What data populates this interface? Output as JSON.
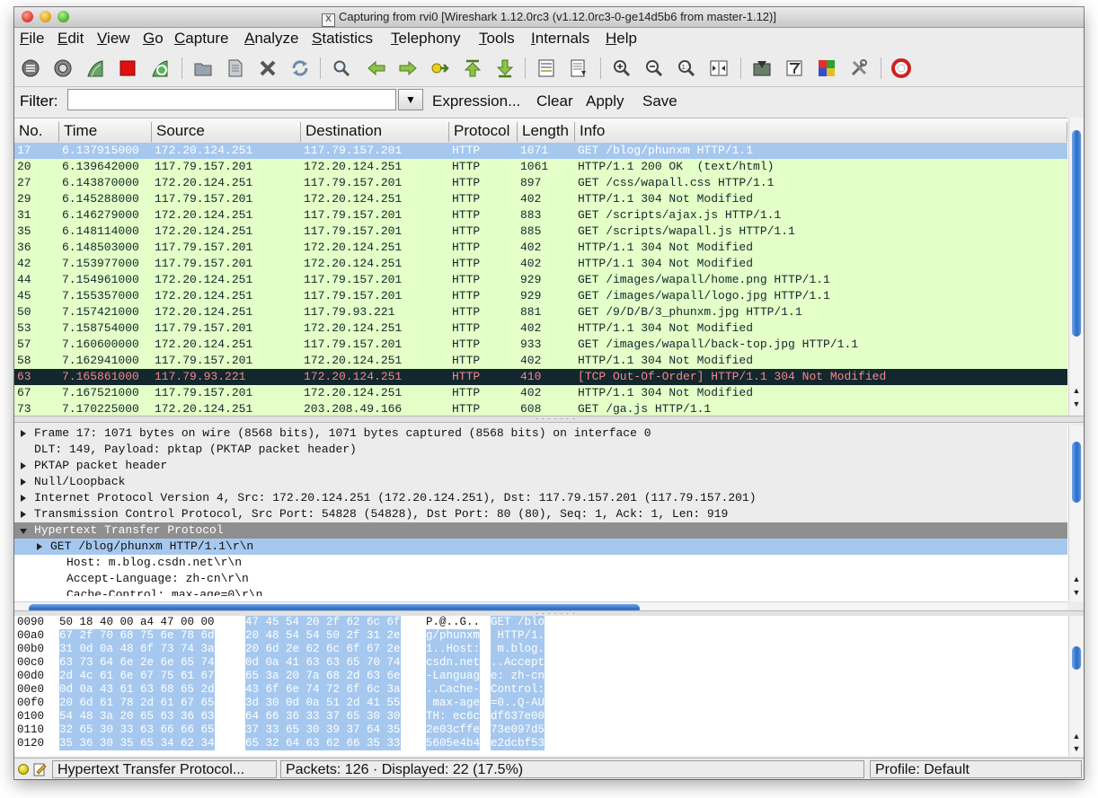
{
  "window": {
    "title": "Capturing from rvi0    [Wireshark 1.12.0rc3  (v1.12.0rc3-0-ge14d5b6 from master-1.12)]",
    "title_badge": "X"
  },
  "menu": [
    "File",
    "Edit",
    "View",
    "Go",
    "Capture",
    "Analyze",
    "Statistics",
    "Telephony",
    "Tools",
    "Internals",
    "Help"
  ],
  "toolbar": {
    "icons": [
      "interfaces-icon",
      "options-icon",
      "start-capture-icon",
      "stop-capture-icon",
      "restart-capture-icon",
      "open-file-icon",
      "save-file-icon",
      "close-file-icon",
      "reload-icon",
      "find-packet-icon",
      "go-back-icon",
      "go-forward-icon",
      "go-to-packet-icon",
      "go-first-icon",
      "go-last-icon",
      "colorize-icon",
      "autoscroll-icon",
      "zoom-in-icon",
      "zoom-out-icon",
      "zoom-normal-icon",
      "resize-columns-icon",
      "capture-filters-icon",
      "display-filters-icon",
      "coloring-rules-icon",
      "preferences-icon",
      "help-icon"
    ]
  },
  "filter": {
    "label": "Filter:",
    "value": "",
    "placeholder": "",
    "expression": "Expression...",
    "clear": "Clear",
    "apply": "Apply",
    "save": "Save"
  },
  "packet_list": {
    "columns": [
      "No.",
      "Time",
      "Source",
      "Destination",
      "Protocol",
      "Length",
      "Info"
    ],
    "rows": [
      {
        "no": "17",
        "time": "6.137915000",
        "src": "172.20.124.251",
        "dst": "117.79.157.201",
        "proto": "HTTP",
        "len": "1071",
        "info": "GET /blog/phunxm HTTP/1.1",
        "state": "sel"
      },
      {
        "no": "20",
        "time": "6.139642000",
        "src": "117.79.157.201",
        "dst": "172.20.124.251",
        "proto": "HTTP",
        "len": "1061",
        "info": "HTTP/1.1 200 OK  (text/html)",
        "state": ""
      },
      {
        "no": "27",
        "time": "6.143870000",
        "src": "172.20.124.251",
        "dst": "117.79.157.201",
        "proto": "HTTP",
        "len": "897",
        "info": "GET /css/wapall.css HTTP/1.1",
        "state": ""
      },
      {
        "no": "29",
        "time": "6.145288000",
        "src": "117.79.157.201",
        "dst": "172.20.124.251",
        "proto": "HTTP",
        "len": "402",
        "info": "HTTP/1.1 304 Not Modified",
        "state": ""
      },
      {
        "no": "31",
        "time": "6.146279000",
        "src": "172.20.124.251",
        "dst": "117.79.157.201",
        "proto": "HTTP",
        "len": "883",
        "info": "GET /scripts/ajax.js HTTP/1.1",
        "state": ""
      },
      {
        "no": "35",
        "time": "6.148114000",
        "src": "172.20.124.251",
        "dst": "117.79.157.201",
        "proto": "HTTP",
        "len": "885",
        "info": "GET /scripts/wapall.js HTTP/1.1",
        "state": ""
      },
      {
        "no": "36",
        "time": "6.148503000",
        "src": "117.79.157.201",
        "dst": "172.20.124.251",
        "proto": "HTTP",
        "len": "402",
        "info": "HTTP/1.1 304 Not Modified",
        "state": ""
      },
      {
        "no": "42",
        "time": "7.153977000",
        "src": "117.79.157.201",
        "dst": "172.20.124.251",
        "proto": "HTTP",
        "len": "402",
        "info": "HTTP/1.1 304 Not Modified",
        "state": ""
      },
      {
        "no": "44",
        "time": "7.154961000",
        "src": "172.20.124.251",
        "dst": "117.79.157.201",
        "proto": "HTTP",
        "len": "929",
        "info": "GET /images/wapall/home.png HTTP/1.1",
        "state": ""
      },
      {
        "no": "45",
        "time": "7.155357000",
        "src": "172.20.124.251",
        "dst": "117.79.157.201",
        "proto": "HTTP",
        "len": "929",
        "info": "GET /images/wapall/logo.jpg HTTP/1.1",
        "state": ""
      },
      {
        "no": "50",
        "time": "7.157421000",
        "src": "172.20.124.251",
        "dst": "117.79.93.221",
        "proto": "HTTP",
        "len": "881",
        "info": "GET /9/D/B/3_phunxm.jpg HTTP/1.1",
        "state": ""
      },
      {
        "no": "53",
        "time": "7.158754000",
        "src": "117.79.157.201",
        "dst": "172.20.124.251",
        "proto": "HTTP",
        "len": "402",
        "info": "HTTP/1.1 304 Not Modified",
        "state": ""
      },
      {
        "no": "57",
        "time": "7.160600000",
        "src": "172.20.124.251",
        "dst": "117.79.157.201",
        "proto": "HTTP",
        "len": "933",
        "info": "GET /images/wapall/back-top.jpg HTTP/1.1",
        "state": ""
      },
      {
        "no": "58",
        "time": "7.162941000",
        "src": "117.79.157.201",
        "dst": "172.20.124.251",
        "proto": "HTTP",
        "len": "402",
        "info": "HTTP/1.1 304 Not Modified",
        "state": ""
      },
      {
        "no": "63",
        "time": "7.165861000",
        "src": "117.79.93.221",
        "dst": "172.20.124.251",
        "proto": "HTTP",
        "len": "410",
        "info": "[TCP Out-Of-Order] HTTP/1.1 304 Not Modified",
        "state": "bad"
      },
      {
        "no": "67",
        "time": "7.167521000",
        "src": "117.79.157.201",
        "dst": "172.20.124.251",
        "proto": "HTTP",
        "len": "402",
        "info": "HTTP/1.1 304 Not Modified",
        "state": ""
      },
      {
        "no": "73",
        "time": "7.170225000",
        "src": "172.20.124.251",
        "dst": "203.208.49.166",
        "proto": "HTTP",
        "len": "608",
        "info": "GET /ga.js HTTP/1.1",
        "state": ""
      }
    ]
  },
  "details": {
    "rows": [
      {
        "indent": 0,
        "tri": "right",
        "text": "Frame 17: 1071 bytes on wire (8568 bits), 1071 bytes captured (8568 bits) on interface 0",
        "style": ""
      },
      {
        "indent": 0,
        "tri": "",
        "text": "DLT: 149, Payload: pktap (PKTAP packet header)",
        "style": ""
      },
      {
        "indent": 0,
        "tri": "right",
        "text": "PKTAP packet header",
        "style": ""
      },
      {
        "indent": 0,
        "tri": "right",
        "text": "Null/Loopback",
        "style": ""
      },
      {
        "indent": 0,
        "tri": "right",
        "text": "Internet Protocol Version 4, Src: 172.20.124.251 (172.20.124.251), Dst: 117.79.157.201 (117.79.157.201)",
        "style": ""
      },
      {
        "indent": 0,
        "tri": "right",
        "text": "Transmission Control Protocol, Src Port: 54828 (54828), Dst Port: 80 (80), Seq: 1, Ack: 1, Len: 919",
        "style": ""
      },
      {
        "indent": 0,
        "tri": "down",
        "text": "Hypertext Transfer Protocol",
        "style": "hdr"
      },
      {
        "indent": 1,
        "tri": "right",
        "text": "GET /blog/phunxm HTTP/1.1\\r\\n",
        "style": "sel"
      },
      {
        "indent": 2,
        "tri": "",
        "text": "Host: m.blog.csdn.net\\r\\n",
        "style": "white"
      },
      {
        "indent": 2,
        "tri": "",
        "text": "Accept-Language: zh-cn\\r\\n",
        "style": "white"
      },
      {
        "indent": 2,
        "tri": "",
        "text": "Cache-Control: max-age=0\\r\\n",
        "style": "white"
      }
    ]
  },
  "bytes": {
    "rows": [
      {
        "off": "0090",
        "hex1": "50 18 40 00 a4 47 00 00",
        "hex2": "47 45 54 20 2f 62 6c 6f",
        "asc1": "P.@..G..",
        "asc2": "GET /blo",
        "hl_start": 8
      },
      {
        "off": "00a0",
        "hex1": "67 2f 70 68 75 6e 78 6d",
        "hex2": "20 48 54 54 50 2f 31 2e",
        "asc1": "g/phunxm",
        "asc2": " HTTP/1.",
        "hl_start": 0
      },
      {
        "off": "00b0",
        "hex1": "31 0d 0a 48 6f 73 74 3a",
        "hex2": "20 6d 2e 62 6c 6f 67 2e",
        "asc1": "1..Host:",
        "asc2": " m.blog.",
        "hl_start": 0
      },
      {
        "off": "00c0",
        "hex1": "63 73 64 6e 2e 6e 65 74",
        "hex2": "0d 0a 41 63 63 65 70 74",
        "asc1": "csdn.net",
        "asc2": "..Accept",
        "hl_start": 0
      },
      {
        "off": "00d0",
        "hex1": "2d 4c 61 6e 67 75 61 67",
        "hex2": "65 3a 20 7a 68 2d 63 6e",
        "asc1": "-Languag",
        "asc2": "e: zh-cn",
        "hl_start": 0
      },
      {
        "off": "00e0",
        "hex1": "0d 0a 43 61 63 68 65 2d",
        "hex2": "43 6f 6e 74 72 6f 6c 3a",
        "asc1": "..Cache-",
        "asc2": "Control:",
        "hl_start": 0
      },
      {
        "off": "00f0",
        "hex1": "20 6d 61 78 2d 61 67 65",
        "hex2": "3d 30 0d 0a 51 2d 41 55",
        "asc1": " max-age",
        "asc2": "=0..Q-AU",
        "hl_start": 0
      },
      {
        "off": "0100",
        "hex1": "54 48 3a 20 65 63 36 63",
        "hex2": "64 66 36 33 37 65 30 30",
        "asc1": "TH: ec6c",
        "asc2": "df637e00",
        "hl_start": 0
      },
      {
        "off": "0110",
        "hex1": "32 65 30 33 63 66 66 65",
        "hex2": "37 33 65 30 39 37 64 35",
        "asc1": "2e03cffe",
        "asc2": "73e097d5",
        "hl_start": 0
      },
      {
        "off": "0120",
        "hex1": "35 36 30 35 65 34 62 34",
        "hex2": "65 32 64 63 62 66 35 33",
        "asc1": "5605e4b4",
        "asc2": "e2dcbf53",
        "hl_start": 0
      }
    ]
  },
  "status": {
    "field": "Hypertext Transfer Protocol...",
    "packets": "Packets: 126 · Displayed: 22 (17.5%)",
    "profile": "Profile: Default"
  },
  "colors": {
    "http_row_bg": "#e4ffc7",
    "selected_bg": "#a6c8ef",
    "bad_row_bg": "#12272e",
    "bad_row_fg": "#f78787"
  }
}
